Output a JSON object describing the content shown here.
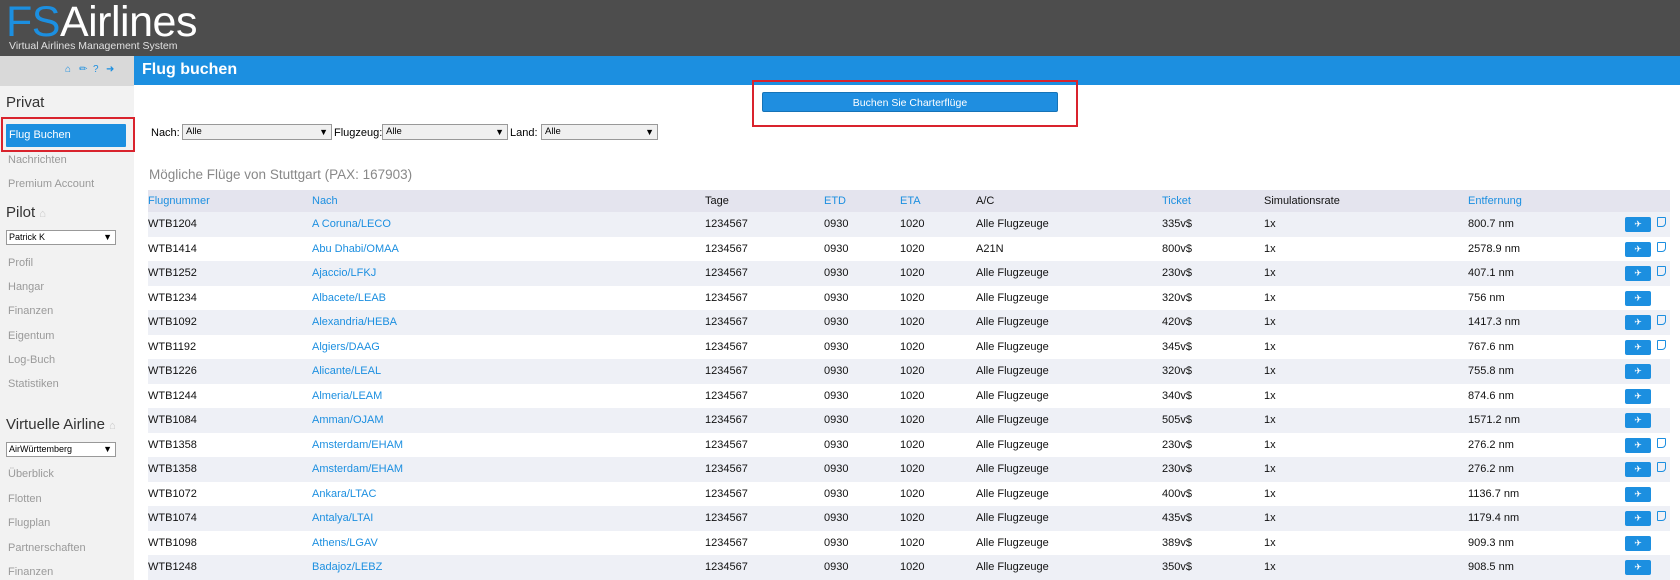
{
  "app": {
    "logo_fs": "FS",
    "logo_rest": "Airlines",
    "tagline": "Virtual Airlines Management System"
  },
  "sidebar": {
    "icons": [
      "home-icon",
      "chat-icon",
      "help-icon",
      "logout-icon"
    ],
    "private_heading": "Privat",
    "private_items": [
      "Flug Buchen",
      "Nachrichten",
      "Premium Account"
    ],
    "pilot_heading": "Pilot",
    "pilot_select": "Patrick K",
    "pilot_items": [
      "Profil",
      "Hangar",
      "Finanzen",
      "Eigentum",
      "Log-Buch",
      "Statistiken"
    ],
    "va_heading": "Virtuelle Airline",
    "va_select": "AirWürttemberg",
    "va_items": [
      "Überblick",
      "Flotten",
      "Flugplan",
      "Partnerschaften",
      "Finanzen"
    ]
  },
  "page": {
    "title": "Flug buchen",
    "charter_button": "Buchen Sie Charterflüge"
  },
  "filters": {
    "nach_label": "Nach:",
    "nach_value": "Alle",
    "flugzeug_label": "Flugzeug:",
    "flugzeug_value": "Alle",
    "land_label": "Land:",
    "land_value": "Alle"
  },
  "flights": {
    "title": "Mögliche Flüge von Stuttgart (PAX: 167903)",
    "columns": [
      "Flugnummer",
      "Nach",
      "Tage",
      "ETD",
      "ETA",
      "A/C",
      "Ticket",
      "Simulationsrate",
      "Entfernung"
    ],
    "rows": [
      {
        "num": "WTB1204",
        "dest": "A Coruna/LECO",
        "days": "1234567",
        "etd": "0930",
        "eta": "1020",
        "ac": "Alle Flugzeuge",
        "ticket": "335v$",
        "rate": "1x",
        "dist": "800.7 nm",
        "note": true
      },
      {
        "num": "WTB1414",
        "dest": "Abu Dhabi/OMAA",
        "days": "1234567",
        "etd": "0930",
        "eta": "1020",
        "ac": "A21N",
        "ticket": "800v$",
        "rate": "1x",
        "dist": "2578.9 nm",
        "note": true
      },
      {
        "num": "WTB1252",
        "dest": "Ajaccio/LFKJ",
        "days": "1234567",
        "etd": "0930",
        "eta": "1020",
        "ac": "Alle Flugzeuge",
        "ticket": "230v$",
        "rate": "1x",
        "dist": "407.1 nm",
        "note": true
      },
      {
        "num": "WTB1234",
        "dest": "Albacete/LEAB",
        "days": "1234567",
        "etd": "0930",
        "eta": "1020",
        "ac": "Alle Flugzeuge",
        "ticket": "320v$",
        "rate": "1x",
        "dist": "756 nm",
        "note": false
      },
      {
        "num": "WTB1092",
        "dest": "Alexandria/HEBA",
        "days": "1234567",
        "etd": "0930",
        "eta": "1020",
        "ac": "Alle Flugzeuge",
        "ticket": "420v$",
        "rate": "1x",
        "dist": "1417.3 nm",
        "note": true
      },
      {
        "num": "WTB1192",
        "dest": "Algiers/DAAG",
        "days": "1234567",
        "etd": "0930",
        "eta": "1020",
        "ac": "Alle Flugzeuge",
        "ticket": "345v$",
        "rate": "1x",
        "dist": "767.6 nm",
        "note": true
      },
      {
        "num": "WTB1226",
        "dest": "Alicante/LEAL",
        "days": "1234567",
        "etd": "0930",
        "eta": "1020",
        "ac": "Alle Flugzeuge",
        "ticket": "320v$",
        "rate": "1x",
        "dist": "755.8 nm",
        "note": false
      },
      {
        "num": "WTB1244",
        "dest": "Almeria/LEAM",
        "days": "1234567",
        "etd": "0930",
        "eta": "1020",
        "ac": "Alle Flugzeuge",
        "ticket": "340v$",
        "rate": "1x",
        "dist": "874.6 nm",
        "note": false
      },
      {
        "num": "WTB1084",
        "dest": "Amman/OJAM",
        "days": "1234567",
        "etd": "0930",
        "eta": "1020",
        "ac": "Alle Flugzeuge",
        "ticket": "505v$",
        "rate": "1x",
        "dist": "1571.2 nm",
        "note": false
      },
      {
        "num": "WTB1358",
        "dest": "Amsterdam/EHAM",
        "days": "1234567",
        "etd": "0930",
        "eta": "1020",
        "ac": "Alle Flugzeuge",
        "ticket": "230v$",
        "rate": "1x",
        "dist": "276.2 nm",
        "note": true
      },
      {
        "num": "WTB1358",
        "dest": "Amsterdam/EHAM",
        "days": "1234567",
        "etd": "0930",
        "eta": "1020",
        "ac": "Alle Flugzeuge",
        "ticket": "230v$",
        "rate": "1x",
        "dist": "276.2 nm",
        "note": true
      },
      {
        "num": "WTB1072",
        "dest": "Ankara/LTAC",
        "days": "1234567",
        "etd": "0930",
        "eta": "1020",
        "ac": "Alle Flugzeuge",
        "ticket": "400v$",
        "rate": "1x",
        "dist": "1136.7 nm",
        "note": false
      },
      {
        "num": "WTB1074",
        "dest": "Antalya/LTAI",
        "days": "1234567",
        "etd": "0930",
        "eta": "1020",
        "ac": "Alle Flugzeuge",
        "ticket": "435v$",
        "rate": "1x",
        "dist": "1179.4 nm",
        "note": true
      },
      {
        "num": "WTB1098",
        "dest": "Athens/LGAV",
        "days": "1234567",
        "etd": "0930",
        "eta": "1020",
        "ac": "Alle Flugzeuge",
        "ticket": "389v$",
        "rate": "1x",
        "dist": "909.3 nm",
        "note": false
      },
      {
        "num": "WTB1248",
        "dest": "Badajoz/LEBZ",
        "days": "1234567",
        "etd": "0930",
        "eta": "1020",
        "ac": "Alle Flugzeuge",
        "ticket": "350v$",
        "rate": "1x",
        "dist": "908.5 nm",
        "note": false
      }
    ]
  },
  "colors": {
    "accent": "#1c8fe0",
    "header_bg": "#4d4d4d",
    "highlight_box": "#d9232d"
  }
}
